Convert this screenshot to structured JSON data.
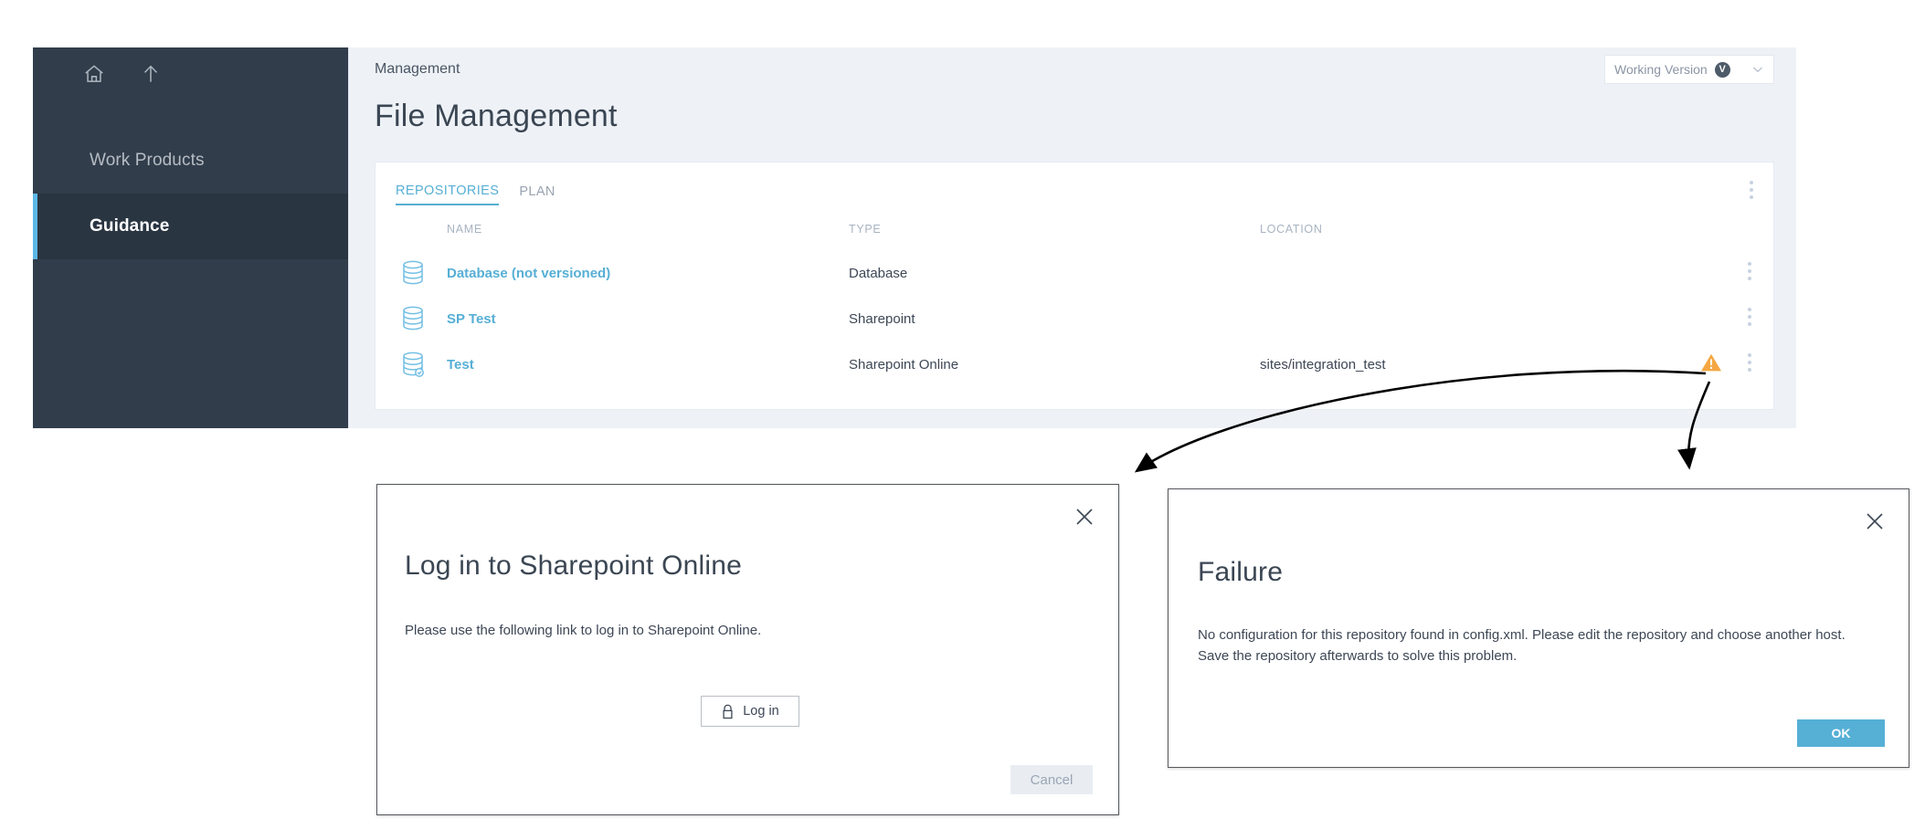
{
  "sidebar": {
    "icons": [
      {
        "name": "home-icon",
        "label": "Home"
      },
      {
        "name": "up-arrow-icon",
        "label": "Up"
      }
    ],
    "items": [
      {
        "label": "Work Products",
        "active": false
      },
      {
        "label": "Guidance",
        "active": true
      }
    ],
    "active_accent": "#5bb7e8",
    "background": "#313d4b"
  },
  "header": {
    "breadcrumb": "Management",
    "page_title": "File Management",
    "version_selector": {
      "label": "Working Version",
      "badge": "V",
      "chevron_icon": "chevron-down-icon"
    }
  },
  "card": {
    "tabs": [
      {
        "label": "REPOSITORIES",
        "active": true
      },
      {
        "label": "PLAN",
        "active": false
      }
    ],
    "overflow_icon": "kebab-menu-icon",
    "table": {
      "columns": [
        "NAME",
        "TYPE",
        "LOCATION"
      ],
      "rows": [
        {
          "icon": "database-icon",
          "name": "Database (not versioned)",
          "type": "Database",
          "location": "",
          "warning": false
        },
        {
          "icon": "database-icon",
          "name": "SP Test",
          "type": "Sharepoint",
          "location": "",
          "warning": false
        },
        {
          "icon": "database-check-icon",
          "name": "Test",
          "type": "Sharepoint Online",
          "location": "sites/integration_test",
          "warning": true
        }
      ]
    }
  },
  "login_dialog": {
    "title": "Log in to Sharepoint Online",
    "body": "Please use the following link to log in to Sharepoint Online.",
    "login_button": "Log in",
    "login_icon": "lock-icon",
    "cancel_button": "Cancel",
    "close_icon": "close-icon"
  },
  "failure_dialog": {
    "title": "Failure",
    "body": "No configuration for this repository found in config.xml. Please edit the repository and choose another host. Save the repository afterwards to solve this problem.",
    "ok_button": "OK",
    "close_icon": "close-icon",
    "ok_color": "#56afd5"
  },
  "colors": {
    "link": "#56afd5",
    "warning": "#f5a742",
    "page_bg": "#eef2f7"
  }
}
